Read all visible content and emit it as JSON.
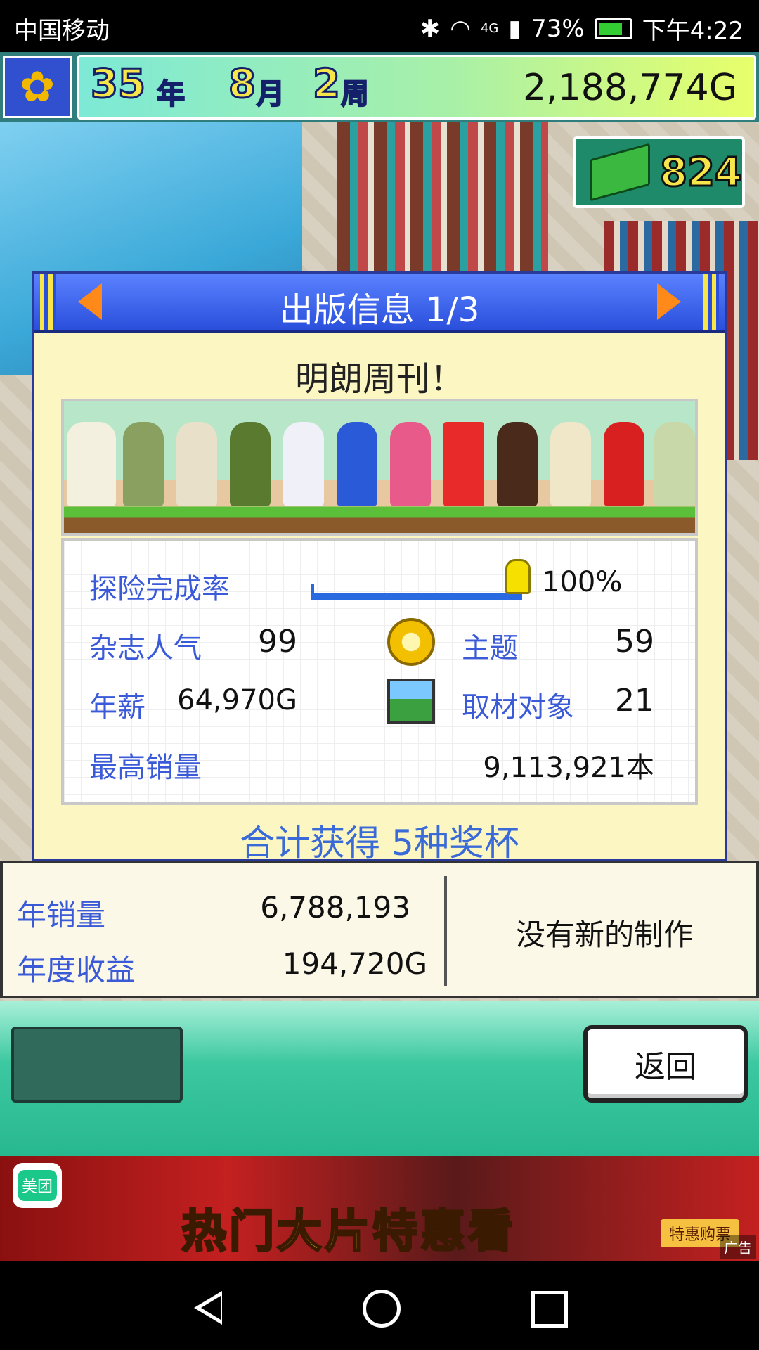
{
  "status_bar": {
    "carrier": "中国移动",
    "network": "4G",
    "battery": "73%",
    "time": "下午4:22"
  },
  "top_bar": {
    "year": "35",
    "year_unit": "年",
    "month": "8",
    "month_unit": "月",
    "week": "2",
    "week_unit": "周",
    "money": "2,188,774G"
  },
  "book_counter": {
    "value": "824",
    "icon": "green-book-icon"
  },
  "panel": {
    "title": "出版信息 1/3",
    "magazine_name": "明朗周刊！",
    "stats": {
      "exploration_label": "探险完成率",
      "exploration_value": "100%",
      "exploration_progress": 1.0,
      "popularity_label": "杂志人气",
      "popularity_value": "99",
      "theme_label": "主题",
      "theme_value": "59",
      "salary_label": "年薪",
      "salary_value": "64,970G",
      "subject_label": "取材对象",
      "subject_value": "21",
      "top_sales_label": "最高销量",
      "top_sales_value": "9,113,921本"
    },
    "trophy_text": "合计获得 5种奖杯"
  },
  "sales": {
    "annual_sales_label": "年销量",
    "annual_sales_value": "6,788,193",
    "annual_revenue_label": "年度收益",
    "annual_revenue_value": "194,720G",
    "no_new_text": "没有新的制作"
  },
  "buttons": {
    "back_label": "返回"
  },
  "ad": {
    "brand": "美团",
    "slogan": "热门大片特惠看",
    "cta": "特惠购票",
    "tag": "广告"
  },
  "colors": {
    "accent_blue": "#3a5ad8",
    "panel_bg": "#fbf6c2",
    "header_blue": "#2a4fdc",
    "bottom_green": "#3cc8a0"
  }
}
